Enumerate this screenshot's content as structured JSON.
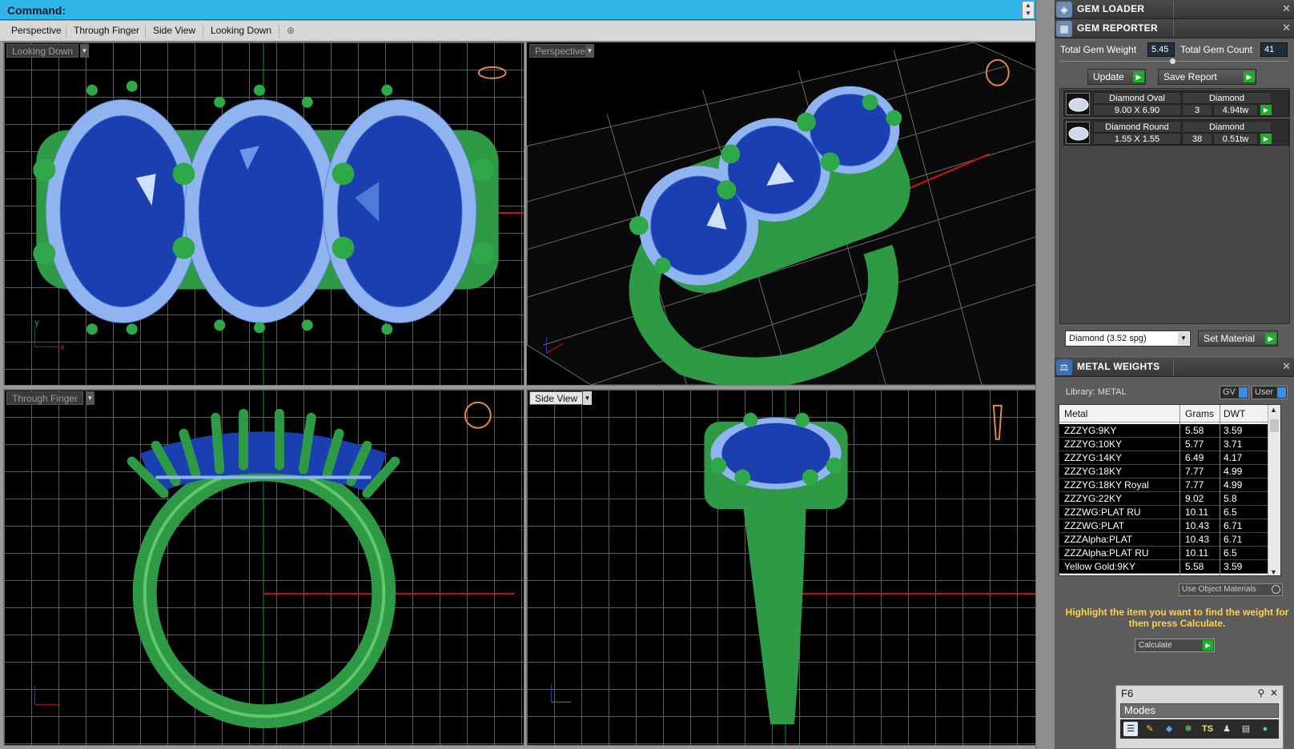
{
  "command": {
    "label": "Command:"
  },
  "viewport_tabs": [
    "Perspective",
    "Through Finger",
    "Side View",
    "Looking Down"
  ],
  "viewports": {
    "top_left": "Looking Down",
    "top_right": "Perspective",
    "bottom_left": "Through Finger",
    "bottom_right": "Side View"
  },
  "axis": {
    "x": "x",
    "y": "y"
  },
  "panels": {
    "gem_loader": "GEM LOADER",
    "gem_reporter": "GEM REPORTER",
    "metal_weights": "METAL WEIGHTS"
  },
  "gem_reporter": {
    "total_weight_label": "Total Gem Weight",
    "total_weight_value": "5.45",
    "total_count_label": "Total Gem Count",
    "total_count_value": "41",
    "update_label": "Update",
    "save_report_label": "Save Report",
    "gems": [
      {
        "shape": "Diamond Oval",
        "material": "Diamond",
        "size": "9.00 X 6.90",
        "count": "3",
        "tw": "4.94tw"
      },
      {
        "shape": "Diamond Round",
        "material": "Diamond",
        "size": "1.55 X 1.55",
        "count": "38",
        "tw": "0.51tw"
      }
    ],
    "material_select": "Diamond    (3.52 spg)",
    "set_material_label": "Set Material"
  },
  "metal_weights": {
    "library_label": "Library: METAL",
    "gv_label": "GV",
    "user_label": "User",
    "columns": [
      "Metal",
      "Grams",
      "DWT"
    ],
    "rows": [
      [
        "ZZZYG:9KY",
        "5.58",
        "3.59"
      ],
      [
        "ZZZYG:10KY",
        "5.77",
        "3.71"
      ],
      [
        "ZZZYG:14KY",
        "6.49",
        "4.17"
      ],
      [
        "ZZZYG:18KY",
        "7.77",
        "4.99"
      ],
      [
        "ZZZYG:18KY Royal",
        "7.77",
        "4.99"
      ],
      [
        "ZZZYG:22KY",
        "9.02",
        "5.8"
      ],
      [
        "ZZZWG:PLAT RU",
        "10.11",
        "6.5"
      ],
      [
        "ZZZWG:PLAT",
        "10.43",
        "6.71"
      ],
      [
        "ZZZAlpha:PLAT",
        "10.43",
        "6.71"
      ],
      [
        "ZZZAlpha:PLAT RU",
        "10.11",
        "6.5"
      ],
      [
        "Yellow Gold:9KY",
        "5.58",
        "3.59"
      ]
    ],
    "use_object_materials": "Use Object Materials",
    "hint": "Highlight the item you want to find the weight for then press Calculate.",
    "calculate_label": "Calculate"
  },
  "f6": {
    "title": "F6",
    "modes_label": "Modes",
    "pin": "⚲",
    "close": "✕"
  },
  "colors": {
    "command_bar": "#2fb5e8",
    "metal": "#2e9a45",
    "gem": "#1a3fb0",
    "accent_go": "#1fae2a",
    "hint": "#ffd24a"
  }
}
